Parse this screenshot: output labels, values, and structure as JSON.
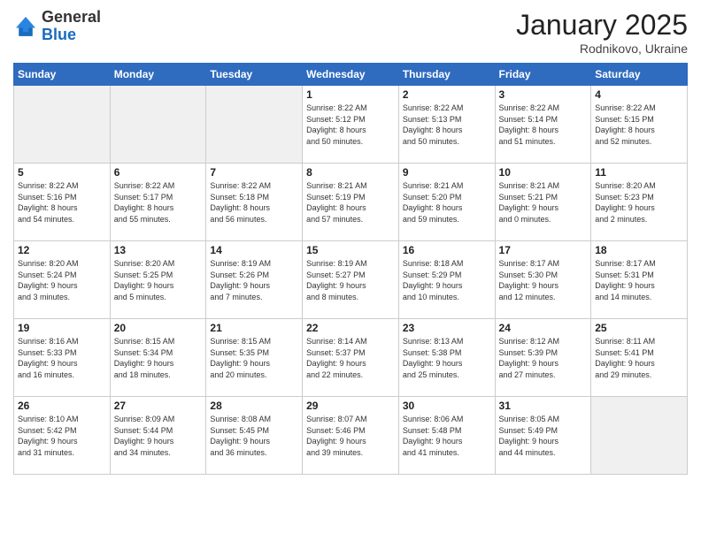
{
  "logo": {
    "general": "General",
    "blue": "Blue"
  },
  "title": {
    "month_year": "January 2025",
    "location": "Rodnikovo, Ukraine"
  },
  "weekdays": [
    "Sunday",
    "Monday",
    "Tuesday",
    "Wednesday",
    "Thursday",
    "Friday",
    "Saturday"
  ],
  "weeks": [
    [
      {
        "day": "",
        "info": "",
        "empty": true
      },
      {
        "day": "",
        "info": "",
        "empty": true
      },
      {
        "day": "",
        "info": "",
        "empty": true
      },
      {
        "day": "1",
        "info": "Sunrise: 8:22 AM\nSunset: 5:12 PM\nDaylight: 8 hours\nand 50 minutes.",
        "empty": false
      },
      {
        "day": "2",
        "info": "Sunrise: 8:22 AM\nSunset: 5:13 PM\nDaylight: 8 hours\nand 50 minutes.",
        "empty": false
      },
      {
        "day": "3",
        "info": "Sunrise: 8:22 AM\nSunset: 5:14 PM\nDaylight: 8 hours\nand 51 minutes.",
        "empty": false
      },
      {
        "day": "4",
        "info": "Sunrise: 8:22 AM\nSunset: 5:15 PM\nDaylight: 8 hours\nand 52 minutes.",
        "empty": false
      }
    ],
    [
      {
        "day": "5",
        "info": "Sunrise: 8:22 AM\nSunset: 5:16 PM\nDaylight: 8 hours\nand 54 minutes.",
        "empty": false
      },
      {
        "day": "6",
        "info": "Sunrise: 8:22 AM\nSunset: 5:17 PM\nDaylight: 8 hours\nand 55 minutes.",
        "empty": false
      },
      {
        "day": "7",
        "info": "Sunrise: 8:22 AM\nSunset: 5:18 PM\nDaylight: 8 hours\nand 56 minutes.",
        "empty": false
      },
      {
        "day": "8",
        "info": "Sunrise: 8:21 AM\nSunset: 5:19 PM\nDaylight: 8 hours\nand 57 minutes.",
        "empty": false
      },
      {
        "day": "9",
        "info": "Sunrise: 8:21 AM\nSunset: 5:20 PM\nDaylight: 8 hours\nand 59 minutes.",
        "empty": false
      },
      {
        "day": "10",
        "info": "Sunrise: 8:21 AM\nSunset: 5:21 PM\nDaylight: 9 hours\nand 0 minutes.",
        "empty": false
      },
      {
        "day": "11",
        "info": "Sunrise: 8:20 AM\nSunset: 5:23 PM\nDaylight: 9 hours\nand 2 minutes.",
        "empty": false
      }
    ],
    [
      {
        "day": "12",
        "info": "Sunrise: 8:20 AM\nSunset: 5:24 PM\nDaylight: 9 hours\nand 3 minutes.",
        "empty": false
      },
      {
        "day": "13",
        "info": "Sunrise: 8:20 AM\nSunset: 5:25 PM\nDaylight: 9 hours\nand 5 minutes.",
        "empty": false
      },
      {
        "day": "14",
        "info": "Sunrise: 8:19 AM\nSunset: 5:26 PM\nDaylight: 9 hours\nand 7 minutes.",
        "empty": false
      },
      {
        "day": "15",
        "info": "Sunrise: 8:19 AM\nSunset: 5:27 PM\nDaylight: 9 hours\nand 8 minutes.",
        "empty": false
      },
      {
        "day": "16",
        "info": "Sunrise: 8:18 AM\nSunset: 5:29 PM\nDaylight: 9 hours\nand 10 minutes.",
        "empty": false
      },
      {
        "day": "17",
        "info": "Sunrise: 8:17 AM\nSunset: 5:30 PM\nDaylight: 9 hours\nand 12 minutes.",
        "empty": false
      },
      {
        "day": "18",
        "info": "Sunrise: 8:17 AM\nSunset: 5:31 PM\nDaylight: 9 hours\nand 14 minutes.",
        "empty": false
      }
    ],
    [
      {
        "day": "19",
        "info": "Sunrise: 8:16 AM\nSunset: 5:33 PM\nDaylight: 9 hours\nand 16 minutes.",
        "empty": false
      },
      {
        "day": "20",
        "info": "Sunrise: 8:15 AM\nSunset: 5:34 PM\nDaylight: 9 hours\nand 18 minutes.",
        "empty": false
      },
      {
        "day": "21",
        "info": "Sunrise: 8:15 AM\nSunset: 5:35 PM\nDaylight: 9 hours\nand 20 minutes.",
        "empty": false
      },
      {
        "day": "22",
        "info": "Sunrise: 8:14 AM\nSunset: 5:37 PM\nDaylight: 9 hours\nand 22 minutes.",
        "empty": false
      },
      {
        "day": "23",
        "info": "Sunrise: 8:13 AM\nSunset: 5:38 PM\nDaylight: 9 hours\nand 25 minutes.",
        "empty": false
      },
      {
        "day": "24",
        "info": "Sunrise: 8:12 AM\nSunset: 5:39 PM\nDaylight: 9 hours\nand 27 minutes.",
        "empty": false
      },
      {
        "day": "25",
        "info": "Sunrise: 8:11 AM\nSunset: 5:41 PM\nDaylight: 9 hours\nand 29 minutes.",
        "empty": false
      }
    ],
    [
      {
        "day": "26",
        "info": "Sunrise: 8:10 AM\nSunset: 5:42 PM\nDaylight: 9 hours\nand 31 minutes.",
        "empty": false
      },
      {
        "day": "27",
        "info": "Sunrise: 8:09 AM\nSunset: 5:44 PM\nDaylight: 9 hours\nand 34 minutes.",
        "empty": false
      },
      {
        "day": "28",
        "info": "Sunrise: 8:08 AM\nSunset: 5:45 PM\nDaylight: 9 hours\nand 36 minutes.",
        "empty": false
      },
      {
        "day": "29",
        "info": "Sunrise: 8:07 AM\nSunset: 5:46 PM\nDaylight: 9 hours\nand 39 minutes.",
        "empty": false
      },
      {
        "day": "30",
        "info": "Sunrise: 8:06 AM\nSunset: 5:48 PM\nDaylight: 9 hours\nand 41 minutes.",
        "empty": false
      },
      {
        "day": "31",
        "info": "Sunrise: 8:05 AM\nSunset: 5:49 PM\nDaylight: 9 hours\nand 44 minutes.",
        "empty": false
      },
      {
        "day": "",
        "info": "",
        "empty": true
      }
    ]
  ]
}
